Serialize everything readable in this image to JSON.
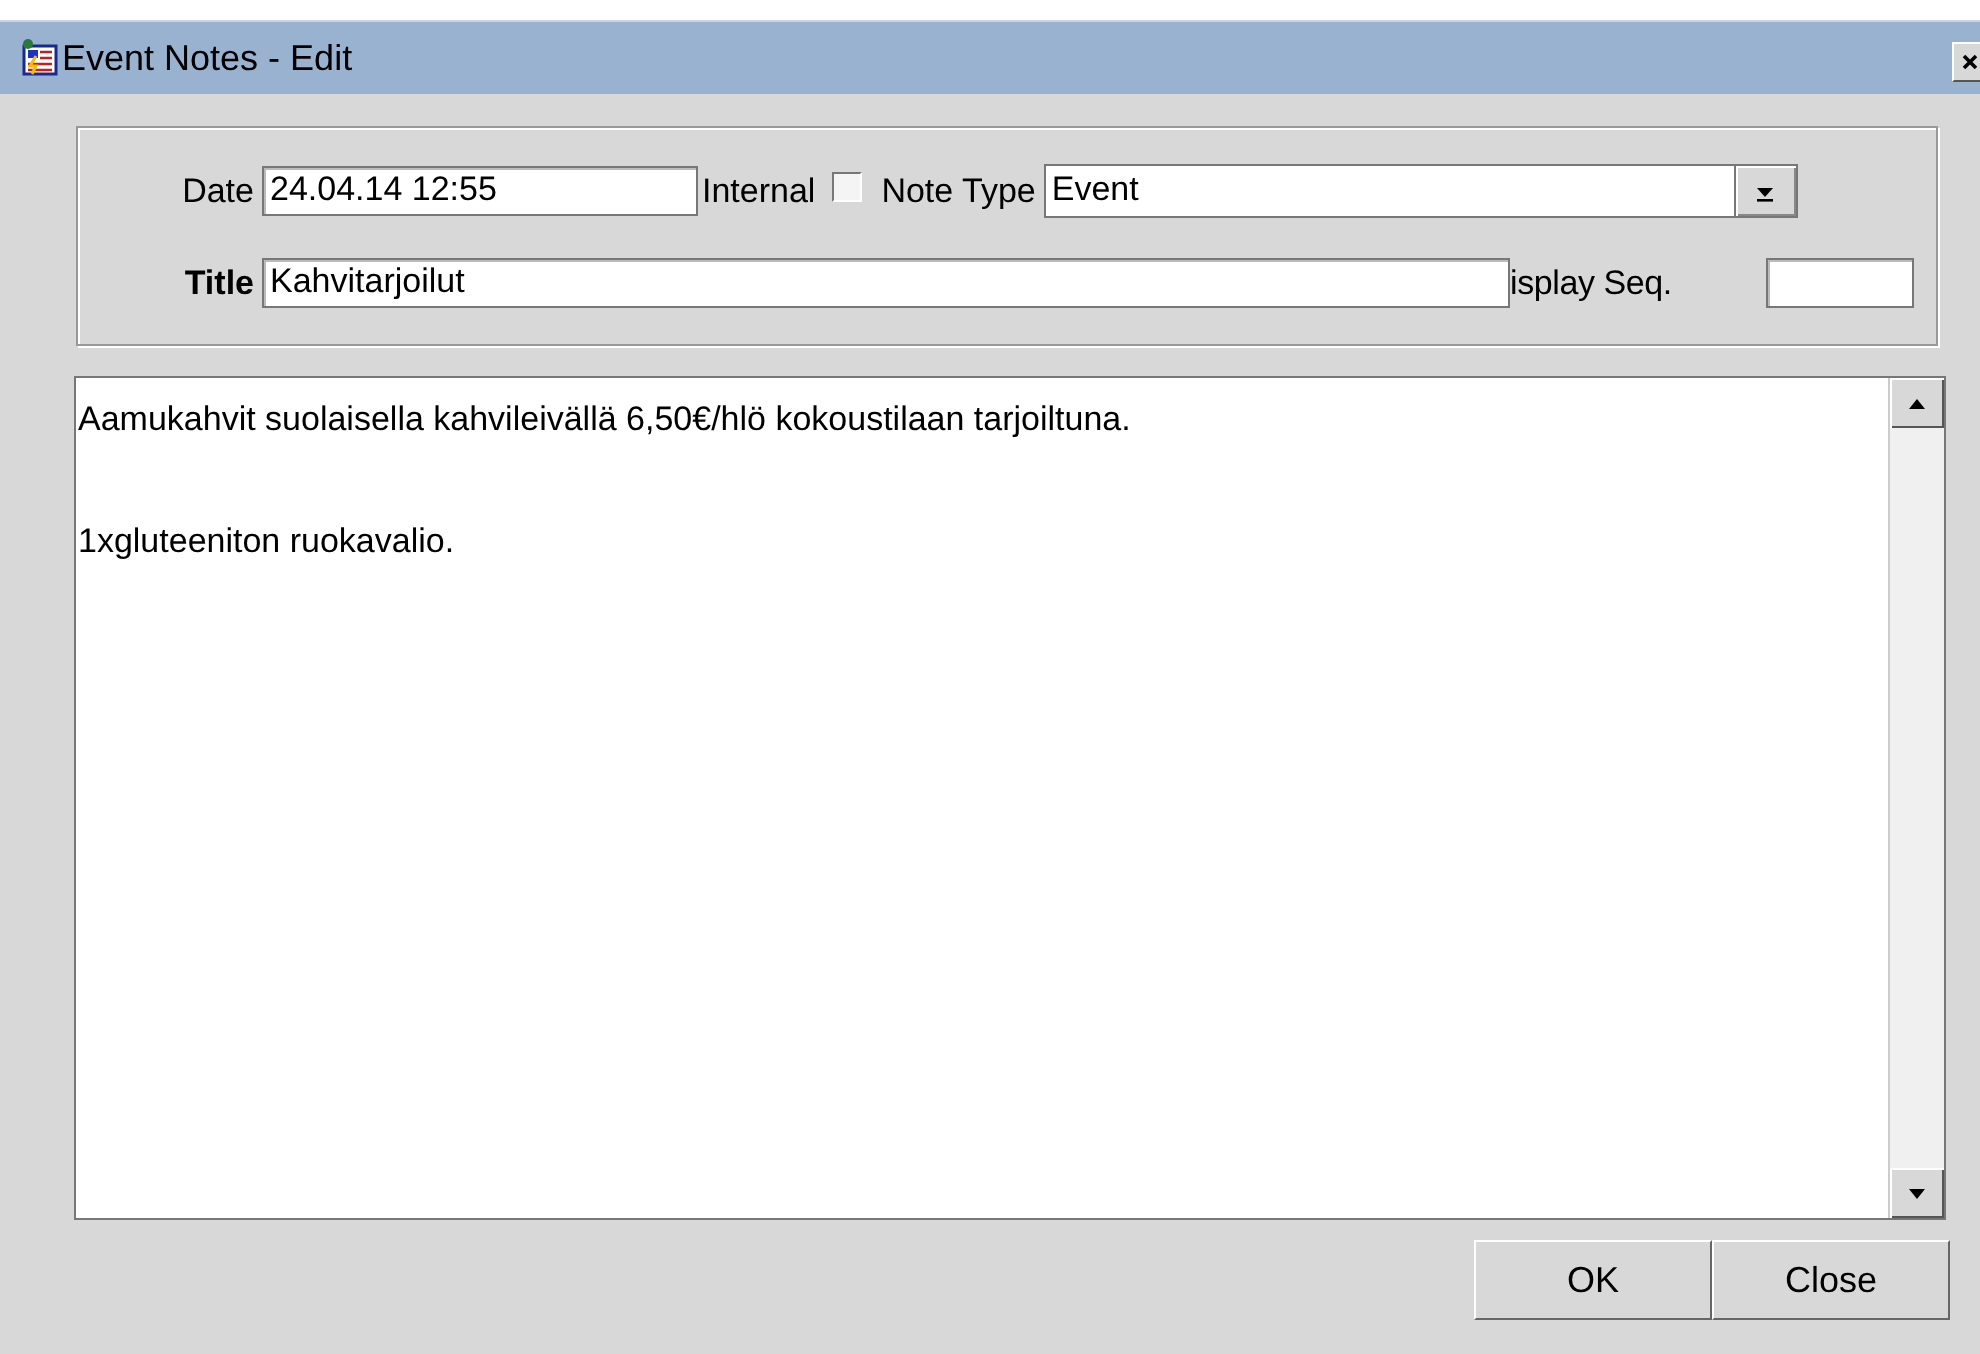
{
  "window": {
    "title": "Event Notes - Edit"
  },
  "form": {
    "date": {
      "label": "Date",
      "value": "24.04.14 12:55"
    },
    "internal": {
      "label": "Internal",
      "checked": false
    },
    "note_type": {
      "label": "Note Type",
      "value": "Event"
    },
    "title": {
      "label": "Title",
      "value": "Kahvitarjoilut"
    },
    "display_seq": {
      "label": "isplay Seq."
    }
  },
  "note_text": [
    "Aamukahvit suolaisella kahvileivällä 6,50€/hlö kokoustilaan tarjoiltuna.",
    "1xgluteeniton ruokavalio."
  ],
  "buttons": [
    "OK",
    "Close"
  ]
}
